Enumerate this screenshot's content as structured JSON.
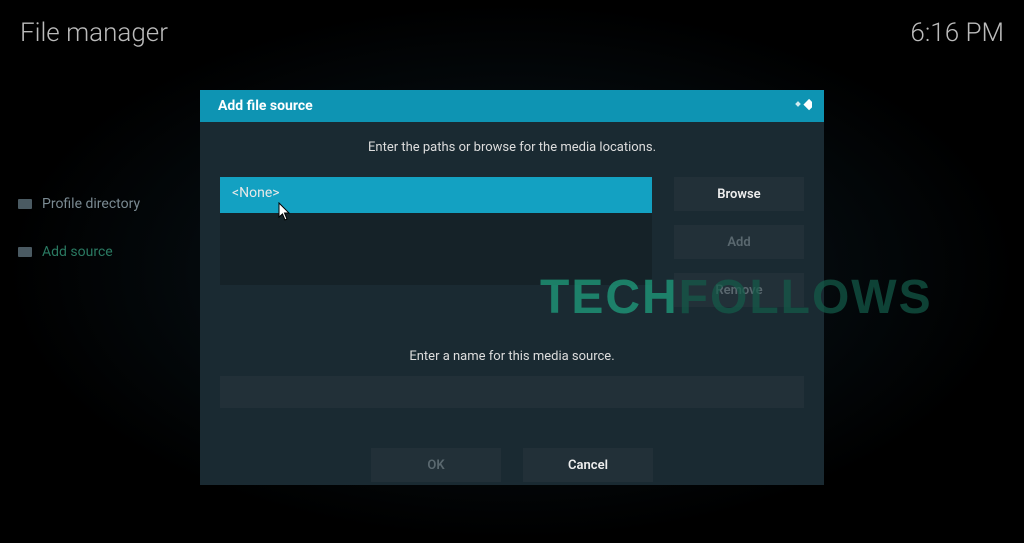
{
  "topbar": {
    "title": "File manager",
    "clock": "6:16 PM"
  },
  "sidebar": {
    "items": [
      {
        "label": "Profile directory",
        "kind": "profile"
      },
      {
        "label": "Add source",
        "kind": "add-src"
      }
    ]
  },
  "dialog": {
    "title": "Add file source",
    "instruction_paths": "Enter the paths or browse for the media locations.",
    "path_entry": "<None>",
    "buttons": {
      "browse": "Browse",
      "add": "Add",
      "remove": "Remove"
    },
    "instruction_name": "Enter a name for this media source.",
    "name_value": "",
    "ok": "OK",
    "cancel": "Cancel"
  },
  "watermark": {
    "part1": "TECH",
    "part2": "FOLLOWS"
  },
  "icons": {
    "kodi": "kodi-logo-icon",
    "folder": "folder-icon",
    "cursor": "cursor-icon"
  }
}
